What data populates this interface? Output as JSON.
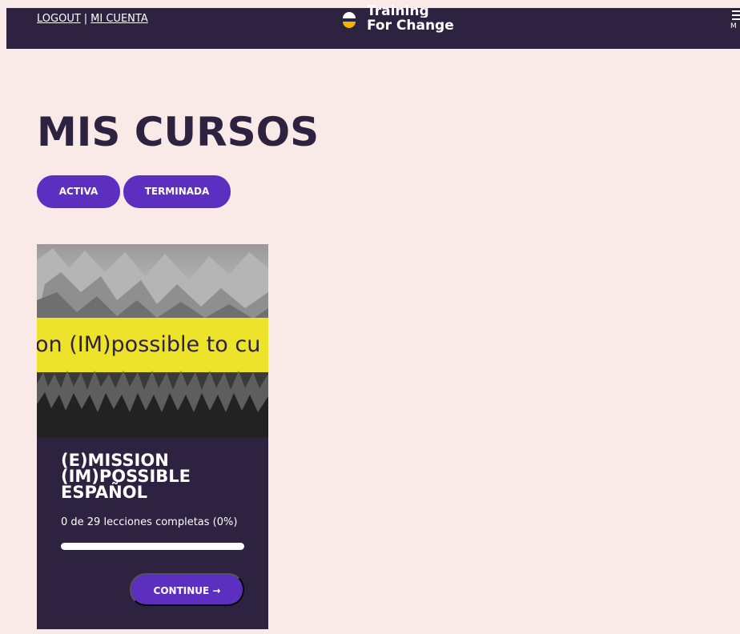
{
  "header": {
    "logout_label": "LOGOUT",
    "separator": "|",
    "account_label": "MI CUENTA",
    "logo_line1": "Training",
    "logo_line2": "For Change",
    "menu_label": "M"
  },
  "main": {
    "title": "MIS CURSOS",
    "filters": [
      {
        "label": "ACTIVA"
      },
      {
        "label": "TERMINADA"
      }
    ]
  },
  "course": {
    "banner_text": "on (IM)possible to cu",
    "title_lines": [
      "(E)MISSION",
      "(IM)POSSIBLE",
      "ESPAÑOL"
    ],
    "progress_text": "0 de 29 lecciones completas (0%)",
    "progress_percent": 0,
    "continue_label": "CONTINUE →"
  },
  "colors": {
    "background": "#f9eae8",
    "header": "#2e2241",
    "accent_purple": "#5d2fc1",
    "banner_yellow": "#ede32a",
    "logo_yellow": "#f5b400"
  },
  "icons": {
    "logo": "training-for-change-logo-icon",
    "menu": "hamburger-menu-icon"
  }
}
